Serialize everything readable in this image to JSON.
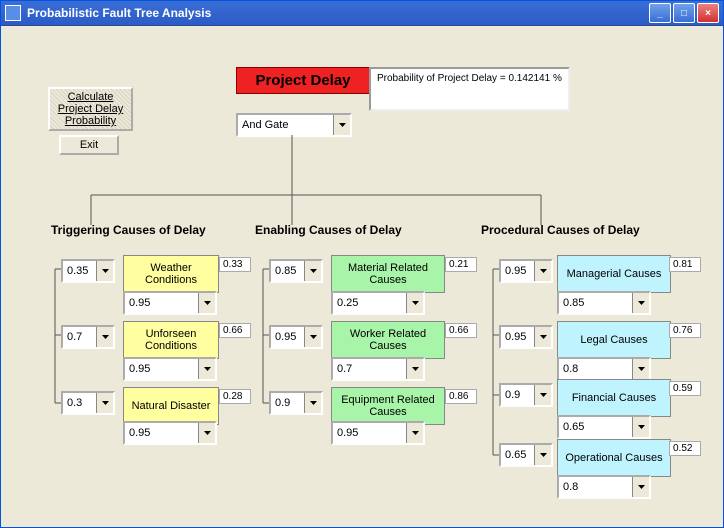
{
  "window": {
    "title": "Probabilistic Fault Tree Analysis"
  },
  "controls": {
    "calc_btn": "Calculate\nProject Delay\nProbability",
    "exit_btn": "Exit"
  },
  "root": {
    "label": "Project Delay",
    "gate": "And Gate",
    "prob_label": "Probability of Project Delay =  0.142141 %"
  },
  "sections": {
    "trig": "Triggering Causes of Delay",
    "enab": "Enabling Causes of Delay",
    "proc": "Procedural Causes of Delay"
  },
  "trig": [
    {
      "p": "0.35",
      "label": "Weather Conditions",
      "q": "0.95",
      "r": "0.33"
    },
    {
      "p": "0.7",
      "label": "Unforseen Conditions",
      "q": "0.95",
      "r": "0.66"
    },
    {
      "p": "0.3",
      "label": "Natural Disaster",
      "q": "0.95",
      "r": "0.28"
    }
  ],
  "enab": [
    {
      "p": "0.85",
      "label": "Material Related Causes",
      "q": "0.25",
      "r": "0.21"
    },
    {
      "p": "0.95",
      "label": "Worker Related Causes",
      "q": "0.7",
      "r": "0.66"
    },
    {
      "p": "0.9",
      "label": "Equipment Related Causes",
      "q": "0.95",
      "r": "0.86"
    }
  ],
  "proc": [
    {
      "p": "0.95",
      "label": "Managerial Causes",
      "q": "0.85",
      "r": "0.81"
    },
    {
      "p": "0.95",
      "label": "Legal Causes",
      "q": "0.8",
      "r": "0.76"
    },
    {
      "p": "0.9",
      "label": "Financial Causes",
      "q": "0.65",
      "r": "0.59"
    },
    {
      "p": "0.65",
      "label": "Operational Causes",
      "q": "0.8",
      "r": "0.52"
    }
  ]
}
